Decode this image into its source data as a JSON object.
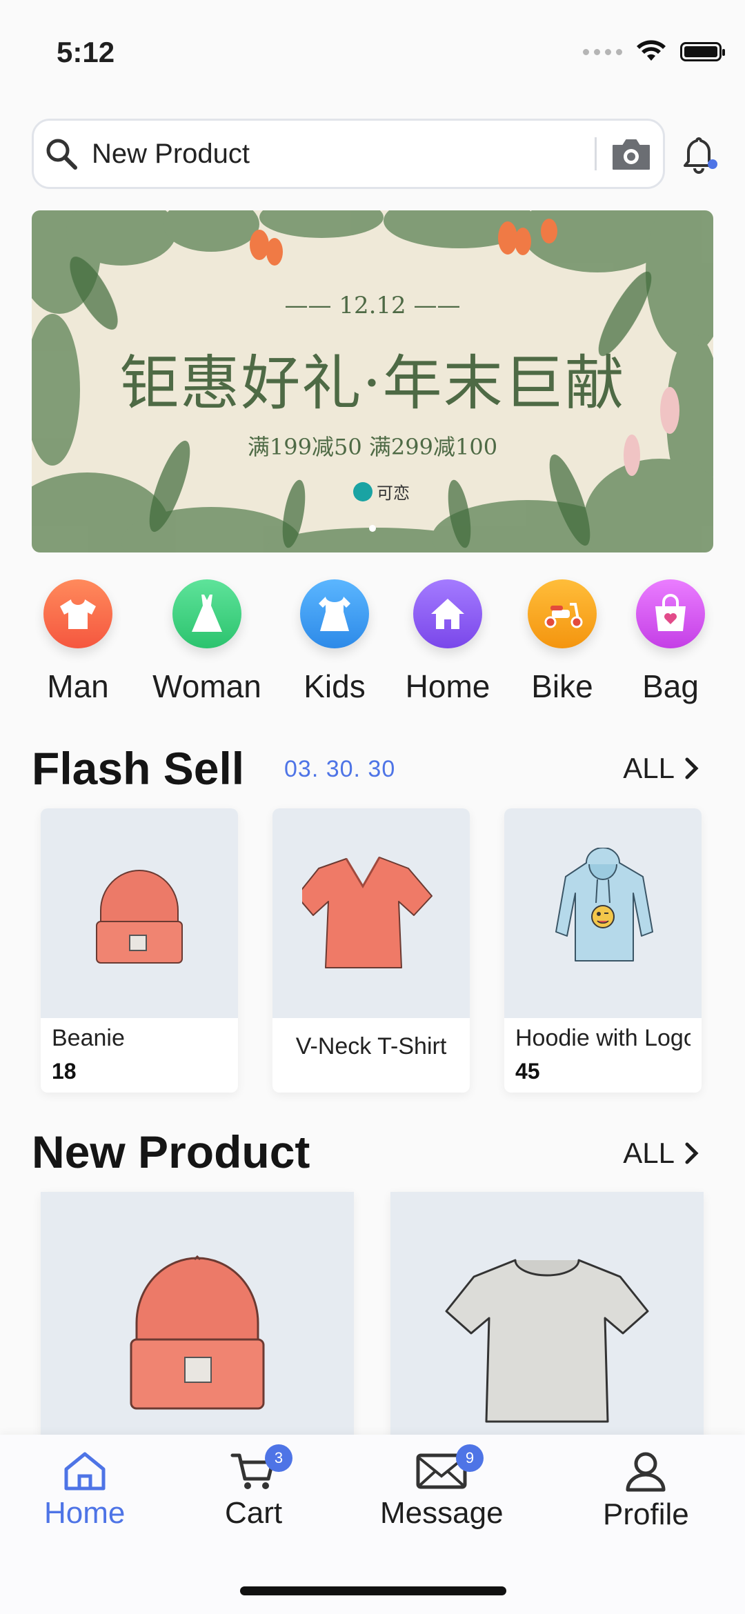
{
  "status_bar": {
    "time": "5:12"
  },
  "search": {
    "placeholder": "New Product"
  },
  "banner": {
    "date": "—— 12.12 ——",
    "title": "钜惠好礼·年末巨献",
    "subtitle": "满199减50 满299减100",
    "brand": "可恋"
  },
  "categories": [
    {
      "label": "Man",
      "icon": "tshirt-icon",
      "color": "#f8664f"
    },
    {
      "label": "Woman",
      "icon": "dress-icon",
      "color": "#3fd37f"
    },
    {
      "label": "Kids",
      "icon": "kids-dress-icon",
      "color": "#3a9cf2"
    },
    {
      "label": "Home",
      "icon": "house-icon",
      "color": "#8b5bf0"
    },
    {
      "label": "Bike",
      "icon": "scooter-icon",
      "color": "#f6a21a"
    },
    {
      "label": "Bag",
      "icon": "bag-icon",
      "color": "#d757ef"
    }
  ],
  "flash_sell": {
    "title": "Flash Sell",
    "timer": "03. 30. 30",
    "all_label": "ALL",
    "items": [
      {
        "name": "Beanie",
        "price": "18"
      },
      {
        "name": "V-Neck T-Shirt",
        "price": ""
      },
      {
        "name": "Hoodie with Logo",
        "price": "45"
      }
    ]
  },
  "new_product": {
    "title": "New Product",
    "all_label": "ALL"
  },
  "tab_bar": {
    "tabs": [
      {
        "label": "Home",
        "active": true
      },
      {
        "label": "Cart",
        "badge": "3"
      },
      {
        "label": "Message",
        "badge": "9"
      },
      {
        "label": "Profile"
      }
    ]
  },
  "colors": {
    "accent": "#4e74e6"
  }
}
